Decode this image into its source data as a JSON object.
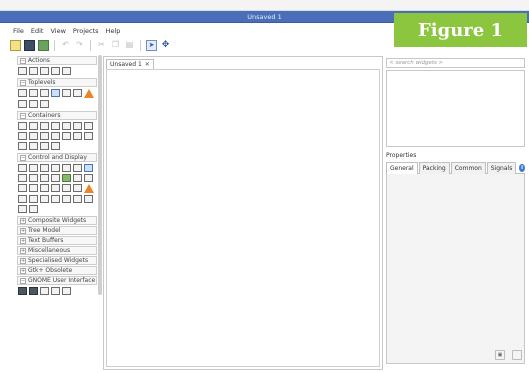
{
  "window": {
    "title": "Unsaved 1"
  },
  "menu": [
    "File",
    "Edit",
    "View",
    "Projects",
    "Help"
  ],
  "badge": {
    "text": "Figure 1",
    "color": "#8cc63f"
  },
  "toolbar": {
    "icons": [
      "new-icon",
      "open-icon",
      "save-icon",
      "undo-icon",
      "redo-icon",
      "cut-icon",
      "copy-icon",
      "paste-icon",
      "select-pointer-icon",
      "drag-resize-icon"
    ]
  },
  "palette": {
    "groups": [
      {
        "sign": "−",
        "label": "Actions"
      },
      {
        "sign": "−",
        "label": "Toplevels"
      },
      {
        "sign": "−",
        "label": "Containers"
      },
      {
        "sign": "−",
        "label": "Control and Display"
      },
      {
        "sign": "+",
        "label": "Composite Widgets"
      },
      {
        "sign": "+",
        "label": "Tree Model"
      },
      {
        "sign": "+",
        "label": "Text Buffers"
      },
      {
        "sign": "+",
        "label": "Miscellaneous"
      },
      {
        "sign": "+",
        "label": "Specialised Widgets"
      },
      {
        "sign": "+",
        "label": "Gtk+ Obsolete"
      },
      {
        "sign": "−",
        "label": "GNOME User Interface"
      }
    ]
  },
  "editor": {
    "tab_label": "Unsaved 1",
    "close_glyph": "✕"
  },
  "inspector": {
    "search_placeholder": "< search widgets >"
  },
  "properties": {
    "label": "Properties",
    "tabs": [
      "General",
      "Packing",
      "Common",
      "Signals"
    ],
    "active_tab": "General"
  },
  "colors": {
    "titlebar": "#4a6fb8",
    "accent": "#3d7dd3"
  }
}
